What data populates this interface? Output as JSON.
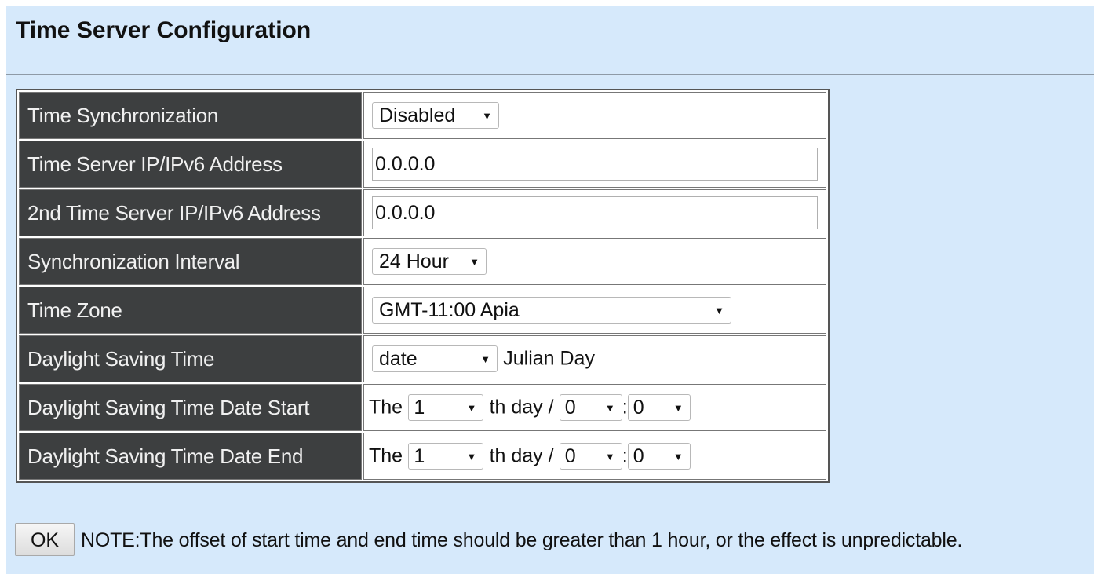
{
  "page": {
    "title": "Time Server Configuration"
  },
  "rows": [
    {
      "label": "Time Synchronization",
      "value": "Disabled"
    },
    {
      "label": "Time Server IP/IPv6 Address",
      "value": "0.0.0.0"
    },
    {
      "label": "2nd Time Server IP/IPv6 Address",
      "value": "0.0.0.0"
    },
    {
      "label": "Synchronization Interval",
      "value": "24 Hour"
    },
    {
      "label": "Time Zone",
      "value": "GMT-11:00 Apia"
    },
    {
      "label": "Daylight Saving Time",
      "value": "date",
      "suffix": "Julian Day"
    },
    {
      "label": "Daylight Saving Time Date Start",
      "prefix": "The",
      "day": "1",
      "day_suffix": "th day /",
      "hour": "0",
      "sep": ":",
      "minute": "0"
    },
    {
      "label": "Daylight Saving Time Date End",
      "prefix": "The",
      "day": "1",
      "day_suffix": "th day /",
      "hour": "0",
      "sep": ":",
      "minute": "0"
    }
  ],
  "footer": {
    "ok_label": "OK",
    "note": "NOTE:The offset of start time and end time should be greater than 1 hour, or the effect is unpredictable."
  },
  "icons": {
    "dropdown": "triangle-down-icon"
  },
  "colors": {
    "background": "#d6e9fb",
    "label_cell": "#3d3f40"
  }
}
